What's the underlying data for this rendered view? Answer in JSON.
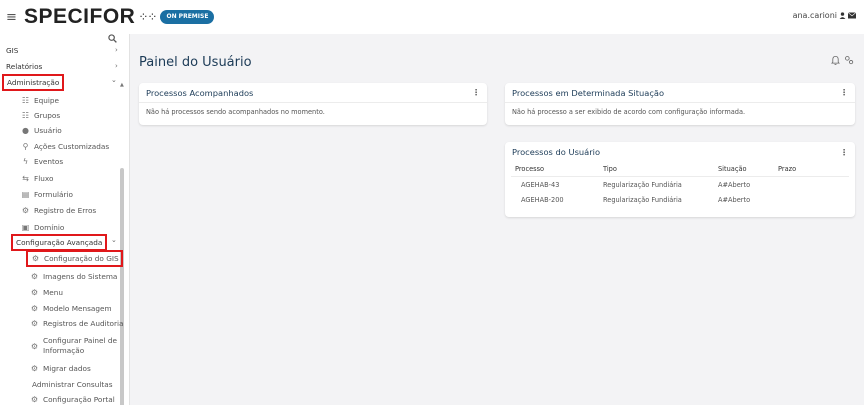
{
  "header": {
    "logo": "SPECIFOR",
    "logo_dots": "⁘⁘",
    "badge": "ON PREMISE",
    "user": "ana.carioni"
  },
  "sidebar": {
    "top_items": [
      {
        "label": "GIS",
        "chevron": "›"
      },
      {
        "label": "Relatórios",
        "chevron": "›"
      },
      {
        "label": "Administração",
        "chevron": "⌄"
      }
    ],
    "admin_items": [
      {
        "label": "Equipe",
        "icon": "team-icon"
      },
      {
        "label": "Grupos",
        "icon": "groups-icon"
      },
      {
        "label": "Usuário",
        "icon": "user-icon"
      },
      {
        "label": "Ações Customizadas",
        "icon": "custom-actions-icon"
      },
      {
        "label": "Eventos",
        "icon": "events-icon"
      },
      {
        "label": "Fluxo",
        "icon": "flow-icon"
      },
      {
        "label": "Formulário",
        "icon": "form-icon"
      },
      {
        "label": "Registro de Erros",
        "icon": "errors-icon"
      },
      {
        "label": "Domínio",
        "icon": "domain-icon"
      }
    ],
    "advanced": {
      "label": "Configuração Avançada",
      "chevron": "⌄"
    },
    "advanced_items": [
      {
        "label": "Configuração do GIS"
      },
      {
        "label": "Imagens do Sistema"
      },
      {
        "label": "Menu"
      },
      {
        "label": "Modelo Mensagem"
      },
      {
        "label": "Registros de Auditoria"
      },
      {
        "label": "Configurar Painel de",
        "label2": "Informação"
      },
      {
        "label": "Migrar dados"
      },
      {
        "label": "Administrar Consultas"
      },
      {
        "label": "Configuração Portal"
      }
    ]
  },
  "main": {
    "title": "Painel do Usuário",
    "cards": {
      "tracked": {
        "title": "Processos Acompanhados",
        "message": "Não há processos sendo acompanhados no momento."
      },
      "situation": {
        "title": "Processos em Determinada Situação",
        "message": "Não há processo a ser exibido de acordo com configuração informada."
      },
      "user_processes": {
        "title": "Processos do Usuário",
        "columns": [
          "Processo",
          "Tipo",
          "Situação",
          "Prazo"
        ],
        "rows": [
          [
            "AGEHAB-43",
            "Regularização Fundiária",
            "A#Aberto",
            ""
          ],
          [
            "AGEHAB-200",
            "Regularização Fundiária",
            "A#Aberto",
            ""
          ]
        ]
      }
    }
  },
  "colors": {
    "accent": "#1b6fa3",
    "title": "#1c3b57",
    "highlight_border": "#e0181b"
  }
}
